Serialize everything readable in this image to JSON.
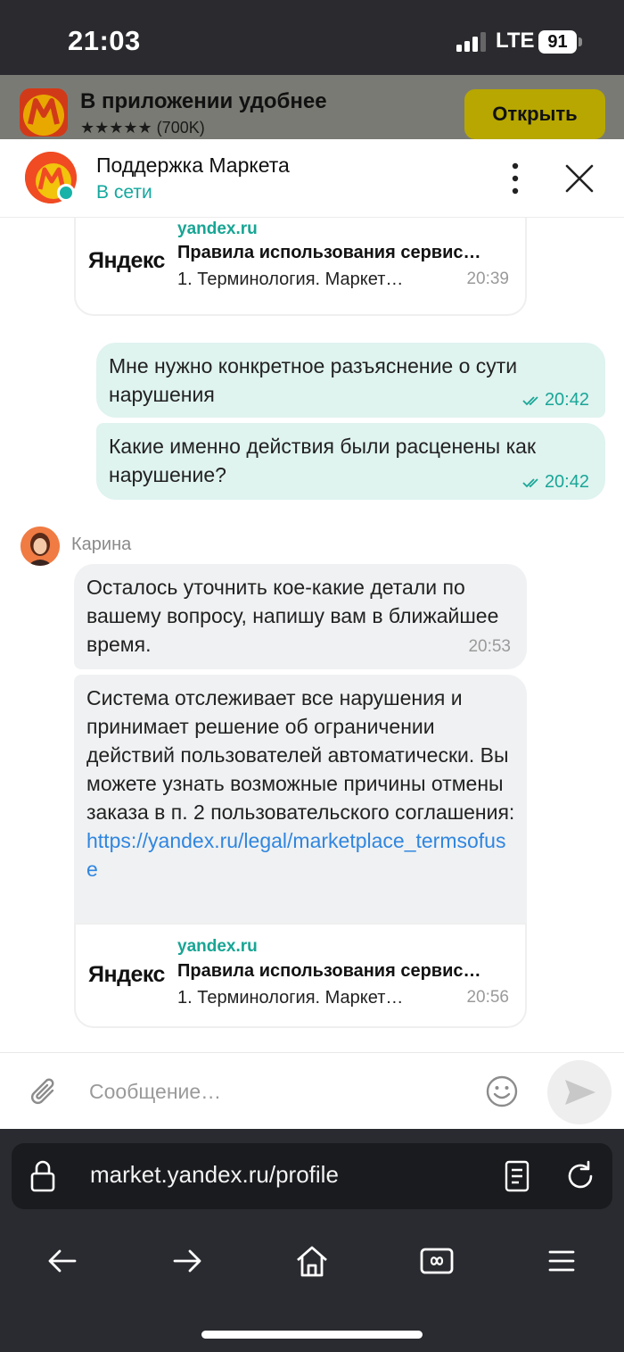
{
  "status_bar": {
    "time": "21:03",
    "network": "LTE",
    "battery": "91"
  },
  "banner": {
    "title": "В приложении удобнее",
    "rating": "★★★★★ (700K)",
    "open_label": "Открыть"
  },
  "chat_header": {
    "name": "Поддержка Маркета",
    "status": "В сети"
  },
  "messages": {
    "card_top": {
      "logo": "Яндекс",
      "domain": "yandex.ru",
      "title": "Правила использования сервис…",
      "desc": "1. Терминология. Маркет…",
      "time": "20:39"
    },
    "outgoing": [
      {
        "text": "Мне нужно конкретное разъяснение о сути нарушения",
        "time": "20:42"
      },
      {
        "text": "Какие именно действия были расценены как нарушение?",
        "time": "20:42"
      }
    ],
    "sender_name": "Карина",
    "incoming_1": {
      "text": "Осталось уточнить кое-какие детали по вашему вопросу, напишу вам в ближайшее время.",
      "time": "20:53"
    },
    "incoming_2": {
      "text": "Система отслеживает все нарушения и принимает решение об ограничении действий пользователей автоматически. Вы можете узнать возможные причины отмены заказа в п. 2 пользовательского соглашения: ",
      "link": "https://yandex.ru/legal/marketplace_termsofuse"
    },
    "card_bottom": {
      "logo": "Яндекс",
      "domain": "yandex.ru",
      "title": "Правила использования сервис…",
      "desc": "1. Терминология. Маркет…",
      "time": "20:56"
    }
  },
  "composer": {
    "placeholder": "Сообщение…"
  },
  "browser": {
    "url": "market.yandex.ru/profile"
  },
  "colors": {
    "accent": "#17b3a8",
    "outgoing_bubble": "#dff3ef",
    "incoming_bubble": "#f0f1f2",
    "link": "#2f86e0"
  }
}
